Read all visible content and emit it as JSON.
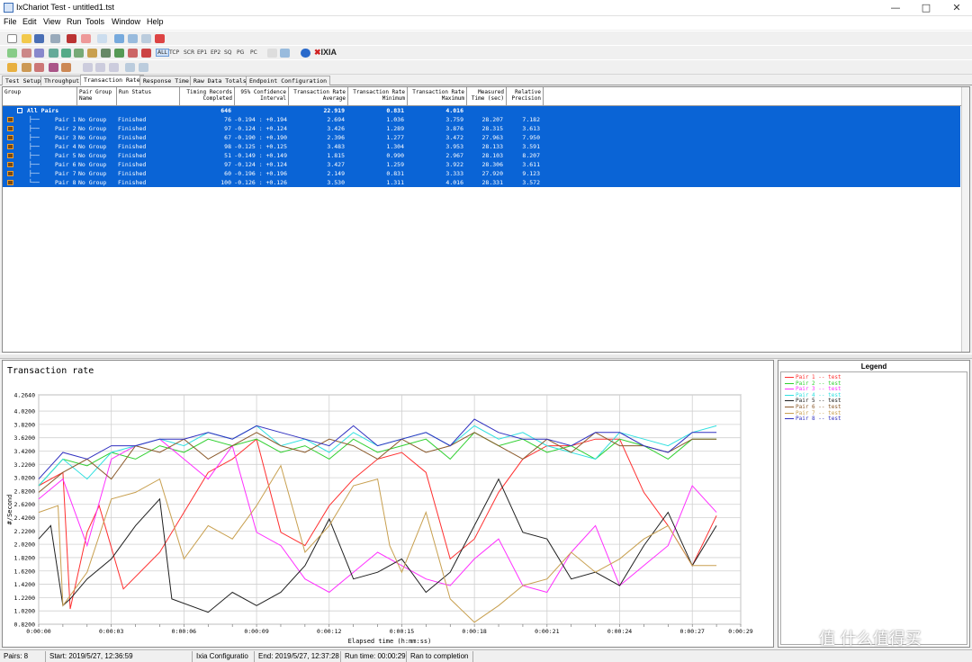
{
  "window": {
    "title": "IxChariot Test - untitled1.tst"
  },
  "menu": [
    "File",
    "Edit",
    "View",
    "Run",
    "Tools",
    "Window",
    "Help"
  ],
  "toolbar": {
    "protocols": [
      "ALL",
      "TCP",
      "SCR",
      "EP1",
      "EP2",
      "SQ",
      "PG",
      "PC"
    ],
    "brand": "IXIA"
  },
  "tabs": [
    "Test Setup",
    "Throughput",
    "Transaction Rate",
    "Response Time",
    "Raw Data Totals",
    "Endpoint Configuration"
  ],
  "grid": {
    "headers": [
      {
        "l1": "",
        "l2": "Group"
      },
      {
        "l1": "Pair Group",
        "l2": "Name"
      },
      {
        "l1": "",
        "l2": "Run Status"
      },
      {
        "l1": "Timing Records",
        "l2": "Completed"
      },
      {
        "l1": "95% Confidence",
        "l2": "Interval"
      },
      {
        "l1": "Transaction Rate",
        "l2": "Average"
      },
      {
        "l1": "Transaction Rate",
        "l2": "Minimum"
      },
      {
        "l1": "Transaction Rate",
        "l2": "Maximum"
      },
      {
        "l1": "Measured",
        "l2": "Time (sec)"
      },
      {
        "l1": "Relative",
        "l2": "Precision"
      }
    ],
    "summary": {
      "label": "All Pairs",
      "records": "646",
      "average": "22.919",
      "minimum": "0.831",
      "maximum": "4.016"
    },
    "rows": [
      {
        "pair": "Pair 1",
        "group": "No Group",
        "status": "Finished",
        "records": "76",
        "ci": "-0.194 : +0.194",
        "avg": "2.694",
        "min": "1.036",
        "max": "3.759",
        "time": "28.207",
        "prec": "7.182"
      },
      {
        "pair": "Pair 2",
        "group": "No Group",
        "status": "Finished",
        "records": "97",
        "ci": "-0.124 : +0.124",
        "avg": "3.426",
        "min": "1.289",
        "max": "3.876",
        "time": "28.315",
        "prec": "3.613"
      },
      {
        "pair": "Pair 3",
        "group": "No Group",
        "status": "Finished",
        "records": "67",
        "ci": "-0.190 : +0.190",
        "avg": "2.396",
        "min": "1.277",
        "max": "3.472",
        "time": "27.963",
        "prec": "7.950"
      },
      {
        "pair": "Pair 4",
        "group": "No Group",
        "status": "Finished",
        "records": "98",
        "ci": "-0.125 : +0.125",
        "avg": "3.483",
        "min": "1.304",
        "max": "3.953",
        "time": "28.133",
        "prec": "3.591"
      },
      {
        "pair": "Pair 5",
        "group": "No Group",
        "status": "Finished",
        "records": "51",
        "ci": "-0.149 : +0.149",
        "avg": "1.815",
        "min": "0.990",
        "max": "2.967",
        "time": "28.103",
        "prec": "8.207"
      },
      {
        "pair": "Pair 6",
        "group": "No Group",
        "status": "Finished",
        "records": "97",
        "ci": "-0.124 : +0.124",
        "avg": "3.427",
        "min": "1.259",
        "max": "3.922",
        "time": "28.306",
        "prec": "3.611"
      },
      {
        "pair": "Pair 7",
        "group": "No Group",
        "status": "Finished",
        "records": "60",
        "ci": "-0.196 : +0.196",
        "avg": "2.149",
        "min": "0.831",
        "max": "3.333",
        "time": "27.920",
        "prec": "9.123"
      },
      {
        "pair": "Pair 8",
        "group": "No Group",
        "status": "Finished",
        "records": "100",
        "ci": "-0.126 : +0.126",
        "avg": "3.530",
        "min": "1.311",
        "max": "4.016",
        "time": "28.331",
        "prec": "3.572"
      }
    ]
  },
  "legend": {
    "title": "Legend",
    "items": [
      {
        "label": "Pair 1 -- test",
        "color": "#ff3030"
      },
      {
        "label": "Pair 2 -- test",
        "color": "#30d030"
      },
      {
        "label": "Pair 3 -- test",
        "color": "#ff30ff"
      },
      {
        "label": "Pair 4 -- test",
        "color": "#30e0e0"
      },
      {
        "label": "Pair 5 -- test",
        "color": "#202020"
      },
      {
        "label": "Pair 6 -- test",
        "color": "#8b5a2b"
      },
      {
        "label": "Pair 7 -- test",
        "color": "#c8a050"
      },
      {
        "label": "Pair 8 -- test",
        "color": "#3030c0"
      }
    ]
  },
  "chart_data": {
    "type": "line",
    "title": "Transaction rate",
    "xlabel": "Elapsed time (h:mm:ss)",
    "ylabel": "#/Second",
    "ylim": [
      0.82,
      4.264
    ],
    "xlim": [
      0,
      29
    ],
    "yticks": [
      "4.2640",
      "4.0200",
      "3.8200",
      "3.6200",
      "3.4200",
      "3.2200",
      "3.0200",
      "2.8200",
      "2.6200",
      "2.4200",
      "2.2200",
      "2.0200",
      "1.8200",
      "1.6200",
      "1.4200",
      "1.2200",
      "1.0200",
      "0.8200"
    ],
    "xticks": [
      "0:00:00",
      "0:00:03",
      "0:00:06",
      "0:00:09",
      "0:00:12",
      "0:00:15",
      "0:00:18",
      "0:00:21",
      "0:00:24",
      "0:00:27",
      "0:00:29"
    ],
    "grid": true,
    "legend_position": "right panel",
    "series": [
      {
        "name": "Pair 1 -- test",
        "x": [
          0,
          1,
          1.3,
          2,
          2.5,
          3.5,
          5,
          6,
          7,
          8,
          9,
          10,
          11,
          12,
          13,
          14,
          15,
          16,
          17,
          18,
          19,
          20,
          21,
          22,
          23,
          24,
          25,
          26,
          27,
          28
        ],
        "y": [
          2.9,
          3.1,
          1.05,
          2.2,
          2.6,
          1.35,
          1.9,
          2.5,
          3.1,
          3.3,
          3.6,
          2.2,
          2.0,
          2.6,
          3.0,
          3.3,
          3.4,
          3.1,
          1.8,
          2.1,
          2.8,
          3.3,
          3.5,
          3.5,
          3.6,
          3.6,
          2.8,
          2.3,
          1.7,
          2.45
        ]
      },
      {
        "name": "Pair 2 -- test",
        "x": [
          0,
          1,
          2,
          3,
          4,
          5,
          6,
          7,
          8,
          9,
          10,
          11,
          12,
          13,
          14,
          15,
          16,
          17,
          18,
          19,
          20,
          21,
          22,
          23,
          24,
          25,
          26,
          27,
          28
        ],
        "y": [
          2.9,
          3.3,
          3.2,
          3.4,
          3.3,
          3.5,
          3.4,
          3.6,
          3.5,
          3.6,
          3.4,
          3.5,
          3.3,
          3.6,
          3.4,
          3.5,
          3.6,
          3.3,
          3.7,
          3.5,
          3.6,
          3.4,
          3.5,
          3.3,
          3.6,
          3.5,
          3.3,
          3.6,
          3.6
        ]
      },
      {
        "name": "Pair 3 -- test",
        "x": [
          0,
          1,
          2,
          3,
          4,
          5,
          6,
          7,
          8,
          9,
          10,
          11,
          12,
          13,
          14,
          15,
          16,
          17,
          18,
          19,
          20,
          21,
          22,
          23,
          24,
          25,
          26,
          27,
          28
        ],
        "y": [
          2.7,
          3.0,
          2.0,
          3.3,
          3.5,
          3.6,
          3.3,
          3.0,
          3.5,
          2.2,
          2.0,
          1.5,
          1.3,
          1.6,
          1.9,
          1.7,
          1.5,
          1.4,
          1.8,
          2.1,
          1.4,
          1.3,
          1.9,
          2.3,
          1.4,
          1.7,
          2.0,
          2.9,
          2.5
        ]
      },
      {
        "name": "Pair 4 -- test",
        "x": [
          0,
          1,
          2,
          3,
          4,
          5,
          6,
          7,
          8,
          9,
          10,
          11,
          12,
          13,
          14,
          15,
          16,
          17,
          18,
          19,
          20,
          21,
          22,
          23,
          24,
          25,
          26,
          27,
          28
        ],
        "y": [
          2.9,
          3.3,
          3.0,
          3.4,
          3.5,
          3.6,
          3.5,
          3.7,
          3.6,
          3.8,
          3.5,
          3.6,
          3.4,
          3.7,
          3.5,
          3.6,
          3.7,
          3.5,
          3.8,
          3.6,
          3.7,
          3.5,
          3.4,
          3.3,
          3.7,
          3.6,
          3.5,
          3.7,
          3.8
        ]
      },
      {
        "name": "Pair 5 -- test",
        "x": [
          0,
          0.5,
          1,
          1.3,
          2,
          3,
          4,
          5,
          5.5,
          7,
          8,
          9,
          10,
          11,
          12,
          13,
          14,
          15,
          16,
          17,
          18,
          19,
          20,
          21,
          22,
          23,
          24,
          25,
          26,
          27,
          28
        ],
        "y": [
          2.1,
          2.3,
          1.1,
          1.2,
          1.5,
          1.8,
          2.3,
          2.7,
          1.2,
          1.0,
          1.3,
          1.1,
          1.3,
          1.7,
          2.4,
          1.5,
          1.6,
          1.8,
          1.3,
          1.6,
          2.3,
          3.0,
          2.2,
          2.1,
          1.5,
          1.6,
          1.4,
          2.0,
          2.5,
          1.7,
          2.3
        ]
      },
      {
        "name": "Pair 6 -- test",
        "x": [
          0,
          1,
          2,
          3,
          4,
          5,
          6,
          7,
          8,
          9,
          10,
          11,
          12,
          13,
          14,
          15,
          16,
          17,
          18,
          19,
          20,
          21,
          22,
          23,
          24,
          25,
          26,
          27,
          28
        ],
        "y": [
          2.8,
          3.1,
          3.3,
          3.0,
          3.5,
          3.4,
          3.6,
          3.3,
          3.5,
          3.7,
          3.5,
          3.4,
          3.6,
          3.5,
          3.3,
          3.6,
          3.4,
          3.5,
          3.7,
          3.5,
          3.3,
          3.6,
          3.4,
          3.7,
          3.5,
          3.5,
          3.4,
          3.6,
          3.6
        ]
      },
      {
        "name": "Pair 7 -- test",
        "x": [
          0,
          0.8,
          1,
          2,
          3,
          4,
          5,
          6,
          7,
          8,
          9,
          10,
          11,
          12,
          13,
          14,
          14.5,
          15,
          16,
          17,
          18,
          19,
          20,
          21,
          22,
          23,
          24,
          25,
          26,
          27,
          28
        ],
        "y": [
          2.5,
          2.6,
          1.1,
          1.6,
          2.7,
          2.8,
          3.0,
          1.8,
          2.3,
          2.1,
          2.6,
          3.2,
          1.9,
          2.3,
          2.9,
          3.0,
          2.0,
          1.6,
          2.5,
          1.2,
          0.85,
          1.1,
          1.4,
          1.5,
          1.9,
          1.6,
          1.8,
          2.1,
          2.3,
          1.7,
          1.7
        ]
      },
      {
        "name": "Pair 8 -- test",
        "x": [
          0,
          1,
          2,
          3,
          4,
          5,
          6,
          7,
          8,
          9,
          10,
          11,
          12,
          13,
          14,
          15,
          16,
          17,
          18,
          19,
          20,
          21,
          22,
          23,
          24,
          25,
          26,
          27,
          28
        ],
        "y": [
          3.0,
          3.4,
          3.3,
          3.5,
          3.5,
          3.6,
          3.6,
          3.7,
          3.6,
          3.8,
          3.7,
          3.6,
          3.5,
          3.8,
          3.5,
          3.6,
          3.7,
          3.5,
          3.9,
          3.7,
          3.6,
          3.6,
          3.5,
          3.7,
          3.7,
          3.5,
          3.4,
          3.7,
          3.7
        ]
      }
    ]
  },
  "status": {
    "pairs": "Pairs: 8",
    "start": "Start: 2019/5/27, 12:36:59",
    "config": "Ixia Configuratio",
    "end": "End: 2019/5/27, 12:37:28",
    "runtime": "Run time: 00:00:29",
    "completion": "Ran to completion"
  },
  "watermark": "值 什么值得买"
}
